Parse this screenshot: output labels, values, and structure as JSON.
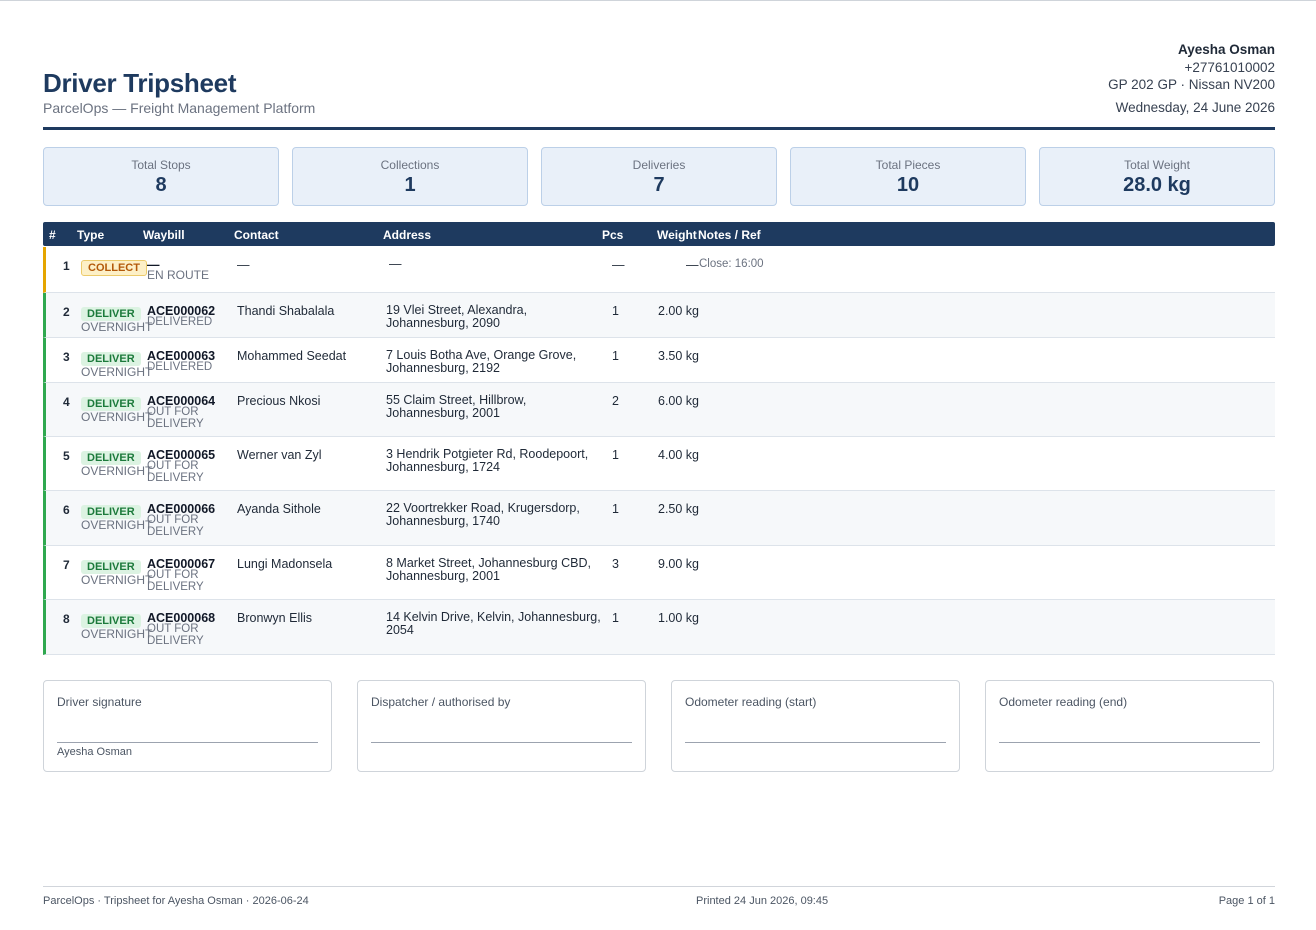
{
  "document": {
    "title": "Driver Tripsheet",
    "subtitle": "ParcelOps — Freight Management Platform"
  },
  "driver": {
    "name": "Ayesha Osman",
    "phone": "+27761010002",
    "vehicle": "GP 202 GP · Nissan NV200",
    "date": "Wednesday, 24 June 2026"
  },
  "stats": [
    {
      "label": "Total Stops",
      "value": "8"
    },
    {
      "label": "Collections",
      "value": "1"
    },
    {
      "label": "Deliveries",
      "value": "7"
    },
    {
      "label": "Total Pieces",
      "value": "10"
    },
    {
      "label": "Total Weight",
      "value": "28.0 kg"
    }
  ],
  "table": {
    "headers": {
      "num": "#",
      "type": "Type",
      "waybill": "Waybill",
      "contact": "Contact",
      "address": "Address",
      "pcs": "Pcs",
      "weight": "Weight",
      "notes": "Notes / Ref"
    },
    "rows": [
      {
        "num": "1",
        "type": "COLLECT",
        "service": "",
        "waybill": "—",
        "status": "EN ROUTE",
        "contact": "—",
        "address": "—",
        "pcs": "—",
        "weight": "—",
        "notes": "Close: 16:00"
      },
      {
        "num": "2",
        "type": "DELIVER",
        "service": "OVERNIGHT",
        "waybill": "ACE000062",
        "status": "DELIVERED",
        "contact": "Thandi Shabalala",
        "address": "19 Vlei Street, Alexandra, Johannesburg, 2090",
        "pcs": "1",
        "weight": "2.00 kg",
        "notes": ""
      },
      {
        "num": "3",
        "type": "DELIVER",
        "service": "OVERNIGHT",
        "waybill": "ACE000063",
        "status": "DELIVERED",
        "contact": "Mohammed Seedat",
        "address": "7 Louis Botha Ave, Orange Grove, Johannesburg, 2192",
        "pcs": "1",
        "weight": "3.50 kg",
        "notes": ""
      },
      {
        "num": "4",
        "type": "DELIVER",
        "service": "OVERNIGHT",
        "waybill": "ACE000064",
        "status": "OUT FOR DELIVERY",
        "contact": "Precious Nkosi",
        "address": "55 Claim Street, Hillbrow, Johannesburg, 2001",
        "pcs": "2",
        "weight": "6.00 kg",
        "notes": ""
      },
      {
        "num": "5",
        "type": "DELIVER",
        "service": "OVERNIGHT",
        "waybill": "ACE000065",
        "status": "OUT FOR DELIVERY",
        "contact": "Werner van Zyl",
        "address": "3 Hendrik Potgieter Rd, Roodepoort, Johannesburg, 1724",
        "pcs": "1",
        "weight": "4.00 kg",
        "notes": ""
      },
      {
        "num": "6",
        "type": "DELIVER",
        "service": "OVERNIGHT",
        "waybill": "ACE000066",
        "status": "OUT FOR DELIVERY",
        "contact": "Ayanda Sithole",
        "address": "22 Voortrekker Road, Krugersdorp, Johannesburg, 1740",
        "pcs": "1",
        "weight": "2.50 kg",
        "notes": ""
      },
      {
        "num": "7",
        "type": "DELIVER",
        "service": "OVERNIGHT",
        "waybill": "ACE000067",
        "status": "OUT FOR DELIVERY",
        "contact": "Lungi Madonsela",
        "address": "8 Market Street, Johannesburg CBD, Johannesburg, 2001",
        "pcs": "3",
        "weight": "9.00 kg",
        "notes": ""
      },
      {
        "num": "8",
        "type": "DELIVER",
        "service": "OVERNIGHT",
        "waybill": "ACE000068",
        "status": "OUT FOR DELIVERY",
        "contact": "Bronwyn Ellis",
        "address": "14 Kelvin Drive, Kelvin, Johannesburg, 2054",
        "pcs": "1",
        "weight": "1.00 kg",
        "notes": ""
      }
    ]
  },
  "signatures": [
    {
      "label": "Driver signature",
      "name": "Ayesha Osman"
    },
    {
      "label": "Dispatcher / authorised by",
      "name": ""
    },
    {
      "label": "Odometer reading (start)",
      "name": ""
    },
    {
      "label": "Odometer reading (end)",
      "name": ""
    }
  ],
  "footer": {
    "left": "ParcelOps · Tripsheet for Ayesha Osman · 2026-06-24",
    "center": "Printed 24 Jun 2026, 09:45",
    "right": "Page 1 of 1"
  },
  "colors": {
    "primary": "#1e3a5f",
    "deliver": "#2fa84f",
    "collect": "#e5a500"
  }
}
